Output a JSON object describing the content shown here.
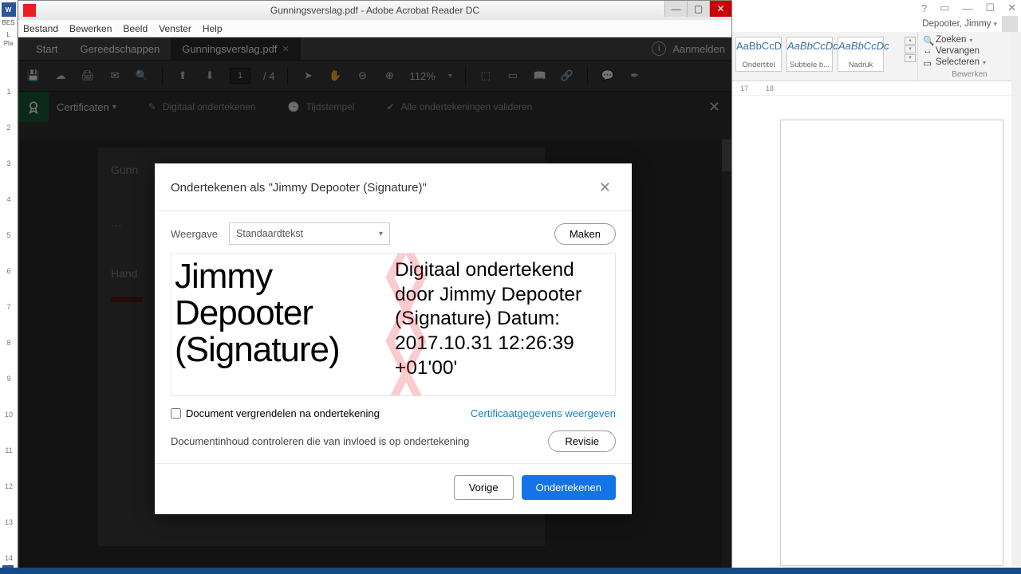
{
  "window": {
    "title": "Gunningsverslag.pdf - Adobe Acrobat Reader DC"
  },
  "menu": {
    "file": "Bestand",
    "edit": "Bewerken",
    "view": "Beeld",
    "window": "Venster",
    "help": "Help"
  },
  "tabs": {
    "start": "Start",
    "tools": "Gereedschappen",
    "doc": "Gunningsverslag.pdf",
    "login": "Aanmelden"
  },
  "toolbar": {
    "page": "1",
    "page_of": "/ 4",
    "zoom": "112%"
  },
  "certbar": {
    "title": "Certificaten",
    "a": "Digitaal ondertekenen",
    "b": "Tijdstempel",
    "c": "Alle ondertekeningen valideren"
  },
  "doc": {
    "line1": "Gunn",
    "line2": "…",
    "line3": "Hand"
  },
  "modal": {
    "title": "Ondertekenen als \"Jimmy Depooter (Signature)\"",
    "weergave": "Weergave",
    "dropdown": "Standaardtekst",
    "maken": "Maken",
    "sig_name": "Jimmy Depooter (Signature)",
    "sig_text": "Digitaal ondertekend door Jimmy Depooter (Signature) Datum: 2017.10.31 12:26:39 +01'00'",
    "lock": "Document vergrendelen na ondertekening",
    "certlink": "Certificaatgegevens weergeven",
    "review": "Documentinhoud controleren die van invloed is op ondertekening",
    "revisie": "Revisie",
    "vorige": "Vorige",
    "onderteken": "Ondertekenen"
  },
  "word": {
    "user": "Depooter, Jimmy",
    "styles": [
      {
        "sample": "AaBbCcD",
        "label": "Ondertitel"
      },
      {
        "sample": "AaBbCcDc",
        "label": "Subtiele b...",
        "italic": true
      },
      {
        "sample": "AaBbCcDc",
        "label": "Nadruk",
        "italic": true
      }
    ],
    "find": "Zoeken",
    "replace": "Vervangen",
    "select": "Selecteren",
    "editgroup": "Bewerken",
    "ruler": [
      "17",
      "18"
    ]
  },
  "leftruler": [
    "1",
    "2",
    "3",
    "4",
    "5",
    "6",
    "7",
    "8",
    "9",
    "10",
    "11",
    "12",
    "13",
    "14"
  ],
  "leftlabels": [
    "L",
    "Pla"
  ]
}
